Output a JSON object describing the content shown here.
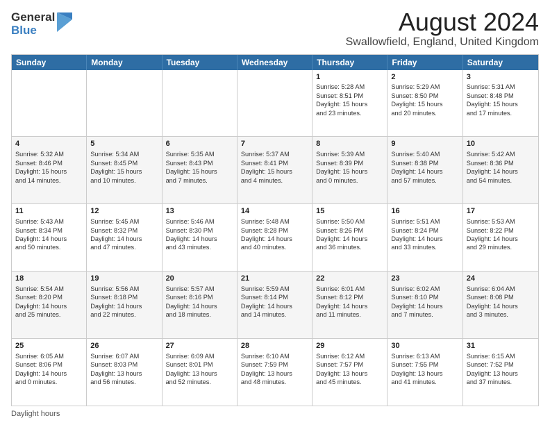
{
  "logo": {
    "general": "General",
    "blue": "Blue"
  },
  "title": "August 2024",
  "subtitle": "Swallowfield, England, United Kingdom",
  "days": [
    "Sunday",
    "Monday",
    "Tuesday",
    "Wednesday",
    "Thursday",
    "Friday",
    "Saturday"
  ],
  "footer": "Daylight hours",
  "weeks": [
    [
      {
        "day": "",
        "info": ""
      },
      {
        "day": "",
        "info": ""
      },
      {
        "day": "",
        "info": ""
      },
      {
        "day": "",
        "info": ""
      },
      {
        "day": "1",
        "info": "Sunrise: 5:28 AM\nSunset: 8:51 PM\nDaylight: 15 hours\nand 23 minutes."
      },
      {
        "day": "2",
        "info": "Sunrise: 5:29 AM\nSunset: 8:50 PM\nDaylight: 15 hours\nand 20 minutes."
      },
      {
        "day": "3",
        "info": "Sunrise: 5:31 AM\nSunset: 8:48 PM\nDaylight: 15 hours\nand 17 minutes."
      }
    ],
    [
      {
        "day": "4",
        "info": "Sunrise: 5:32 AM\nSunset: 8:46 PM\nDaylight: 15 hours\nand 14 minutes."
      },
      {
        "day": "5",
        "info": "Sunrise: 5:34 AM\nSunset: 8:45 PM\nDaylight: 15 hours\nand 10 minutes."
      },
      {
        "day": "6",
        "info": "Sunrise: 5:35 AM\nSunset: 8:43 PM\nDaylight: 15 hours\nand 7 minutes."
      },
      {
        "day": "7",
        "info": "Sunrise: 5:37 AM\nSunset: 8:41 PM\nDaylight: 15 hours\nand 4 minutes."
      },
      {
        "day": "8",
        "info": "Sunrise: 5:39 AM\nSunset: 8:39 PM\nDaylight: 15 hours\nand 0 minutes."
      },
      {
        "day": "9",
        "info": "Sunrise: 5:40 AM\nSunset: 8:38 PM\nDaylight: 14 hours\nand 57 minutes."
      },
      {
        "day": "10",
        "info": "Sunrise: 5:42 AM\nSunset: 8:36 PM\nDaylight: 14 hours\nand 54 minutes."
      }
    ],
    [
      {
        "day": "11",
        "info": "Sunrise: 5:43 AM\nSunset: 8:34 PM\nDaylight: 14 hours\nand 50 minutes."
      },
      {
        "day": "12",
        "info": "Sunrise: 5:45 AM\nSunset: 8:32 PM\nDaylight: 14 hours\nand 47 minutes."
      },
      {
        "day": "13",
        "info": "Sunrise: 5:46 AM\nSunset: 8:30 PM\nDaylight: 14 hours\nand 43 minutes."
      },
      {
        "day": "14",
        "info": "Sunrise: 5:48 AM\nSunset: 8:28 PM\nDaylight: 14 hours\nand 40 minutes."
      },
      {
        "day": "15",
        "info": "Sunrise: 5:50 AM\nSunset: 8:26 PM\nDaylight: 14 hours\nand 36 minutes."
      },
      {
        "day": "16",
        "info": "Sunrise: 5:51 AM\nSunset: 8:24 PM\nDaylight: 14 hours\nand 33 minutes."
      },
      {
        "day": "17",
        "info": "Sunrise: 5:53 AM\nSunset: 8:22 PM\nDaylight: 14 hours\nand 29 minutes."
      }
    ],
    [
      {
        "day": "18",
        "info": "Sunrise: 5:54 AM\nSunset: 8:20 PM\nDaylight: 14 hours\nand 25 minutes."
      },
      {
        "day": "19",
        "info": "Sunrise: 5:56 AM\nSunset: 8:18 PM\nDaylight: 14 hours\nand 22 minutes."
      },
      {
        "day": "20",
        "info": "Sunrise: 5:57 AM\nSunset: 8:16 PM\nDaylight: 14 hours\nand 18 minutes."
      },
      {
        "day": "21",
        "info": "Sunrise: 5:59 AM\nSunset: 8:14 PM\nDaylight: 14 hours\nand 14 minutes."
      },
      {
        "day": "22",
        "info": "Sunrise: 6:01 AM\nSunset: 8:12 PM\nDaylight: 14 hours\nand 11 minutes."
      },
      {
        "day": "23",
        "info": "Sunrise: 6:02 AM\nSunset: 8:10 PM\nDaylight: 14 hours\nand 7 minutes."
      },
      {
        "day": "24",
        "info": "Sunrise: 6:04 AM\nSunset: 8:08 PM\nDaylight: 14 hours\nand 3 minutes."
      }
    ],
    [
      {
        "day": "25",
        "info": "Sunrise: 6:05 AM\nSunset: 8:06 PM\nDaylight: 14 hours\nand 0 minutes."
      },
      {
        "day": "26",
        "info": "Sunrise: 6:07 AM\nSunset: 8:03 PM\nDaylight: 13 hours\nand 56 minutes."
      },
      {
        "day": "27",
        "info": "Sunrise: 6:09 AM\nSunset: 8:01 PM\nDaylight: 13 hours\nand 52 minutes."
      },
      {
        "day": "28",
        "info": "Sunrise: 6:10 AM\nSunset: 7:59 PM\nDaylight: 13 hours\nand 48 minutes."
      },
      {
        "day": "29",
        "info": "Sunrise: 6:12 AM\nSunset: 7:57 PM\nDaylight: 13 hours\nand 45 minutes."
      },
      {
        "day": "30",
        "info": "Sunrise: 6:13 AM\nSunset: 7:55 PM\nDaylight: 13 hours\nand 41 minutes."
      },
      {
        "day": "31",
        "info": "Sunrise: 6:15 AM\nSunset: 7:52 PM\nDaylight: 13 hours\nand 37 minutes."
      }
    ]
  ]
}
